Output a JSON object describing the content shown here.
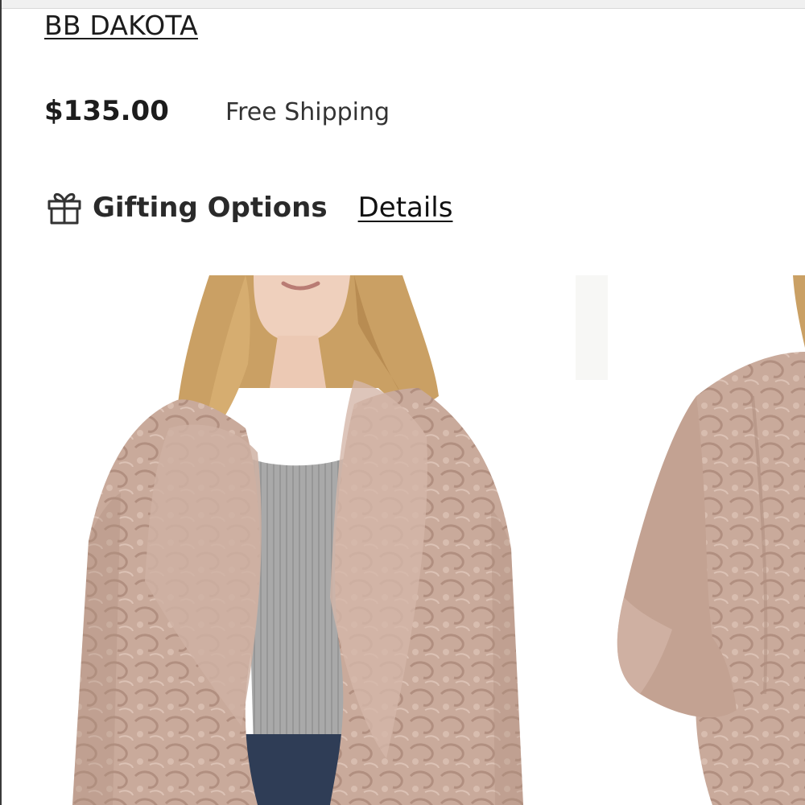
{
  "product": {
    "brand": "BB DAKOTA",
    "price": "$135.00",
    "shipping": "Free Shipping"
  },
  "gifting": {
    "icon": "gift-icon",
    "title": "Gifting Options",
    "details_link": "Details"
  },
  "gallery": {
    "images": [
      {
        "name": "front view",
        "fur_color": "#c7a89a"
      },
      {
        "name": "side view",
        "fur_color": "#c7a89a"
      }
    ]
  },
  "colors": {
    "text": "#1c1c1c",
    "fur": "#c7a89a",
    "top": "#a7a7a7",
    "hair": "#caa064",
    "skin": "#efd0bd",
    "denim": "#2f3d56"
  }
}
